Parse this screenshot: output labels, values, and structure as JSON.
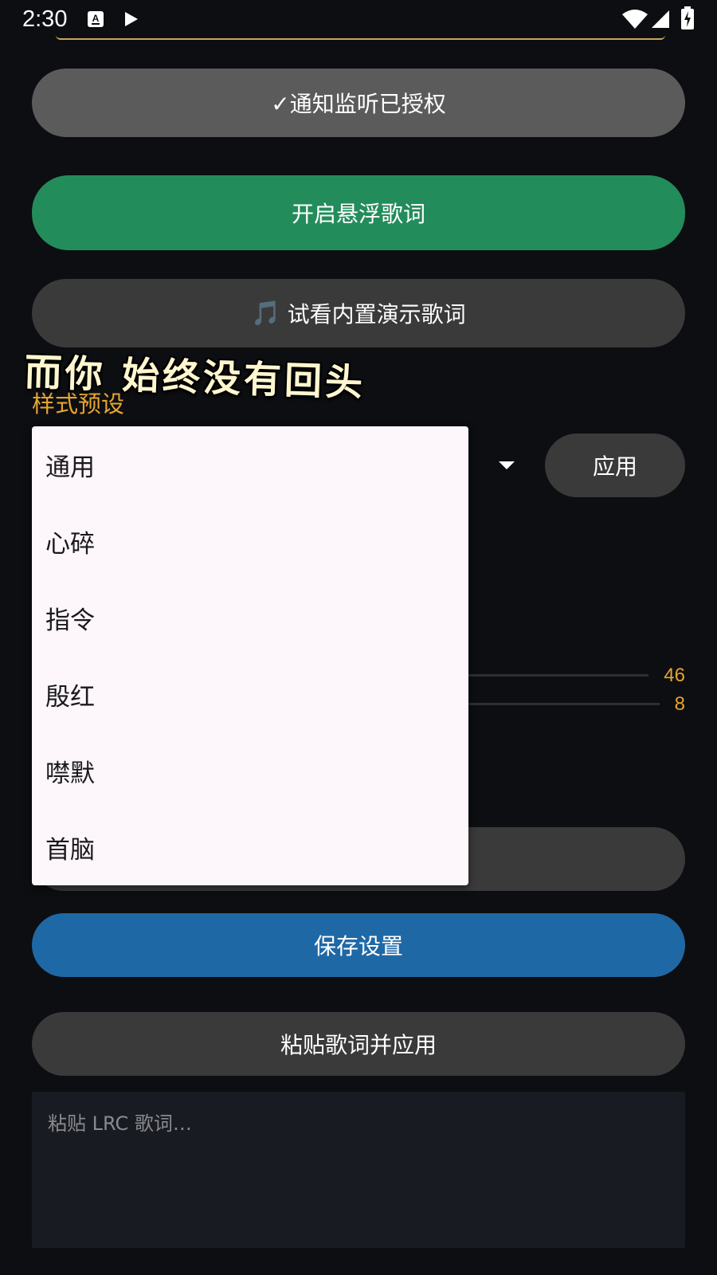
{
  "status_bar": {
    "time": "2:30"
  },
  "buttons": {
    "notify_authorized": "✓通知监听已授权",
    "float_lyrics": "开启悬浮歌词",
    "demo_note_icon": "🎵",
    "demo_lyrics": "试看内置演示歌词",
    "save_settings": "保存设置",
    "paste_apply": "粘贴歌词并应用"
  },
  "lyric_overlay": "而你 始终没有回头",
  "style_presets": {
    "label": "样式预设",
    "apply_label": "应用",
    "options": [
      "通用",
      "心碎",
      "指令",
      "殷红",
      "噤默",
      "首脑"
    ]
  },
  "sliders": {
    "value_1": "46",
    "value_2": "8"
  },
  "lrc_input": {
    "placeholder": "粘贴 LRC 歌词…",
    "value": ""
  },
  "colors": {
    "background": "#0d0e12",
    "accent_orange": "#e6a42f",
    "green_button": "#238c5b",
    "blue_button": "#1f68a6",
    "menu_background": "#fdf6fb"
  }
}
